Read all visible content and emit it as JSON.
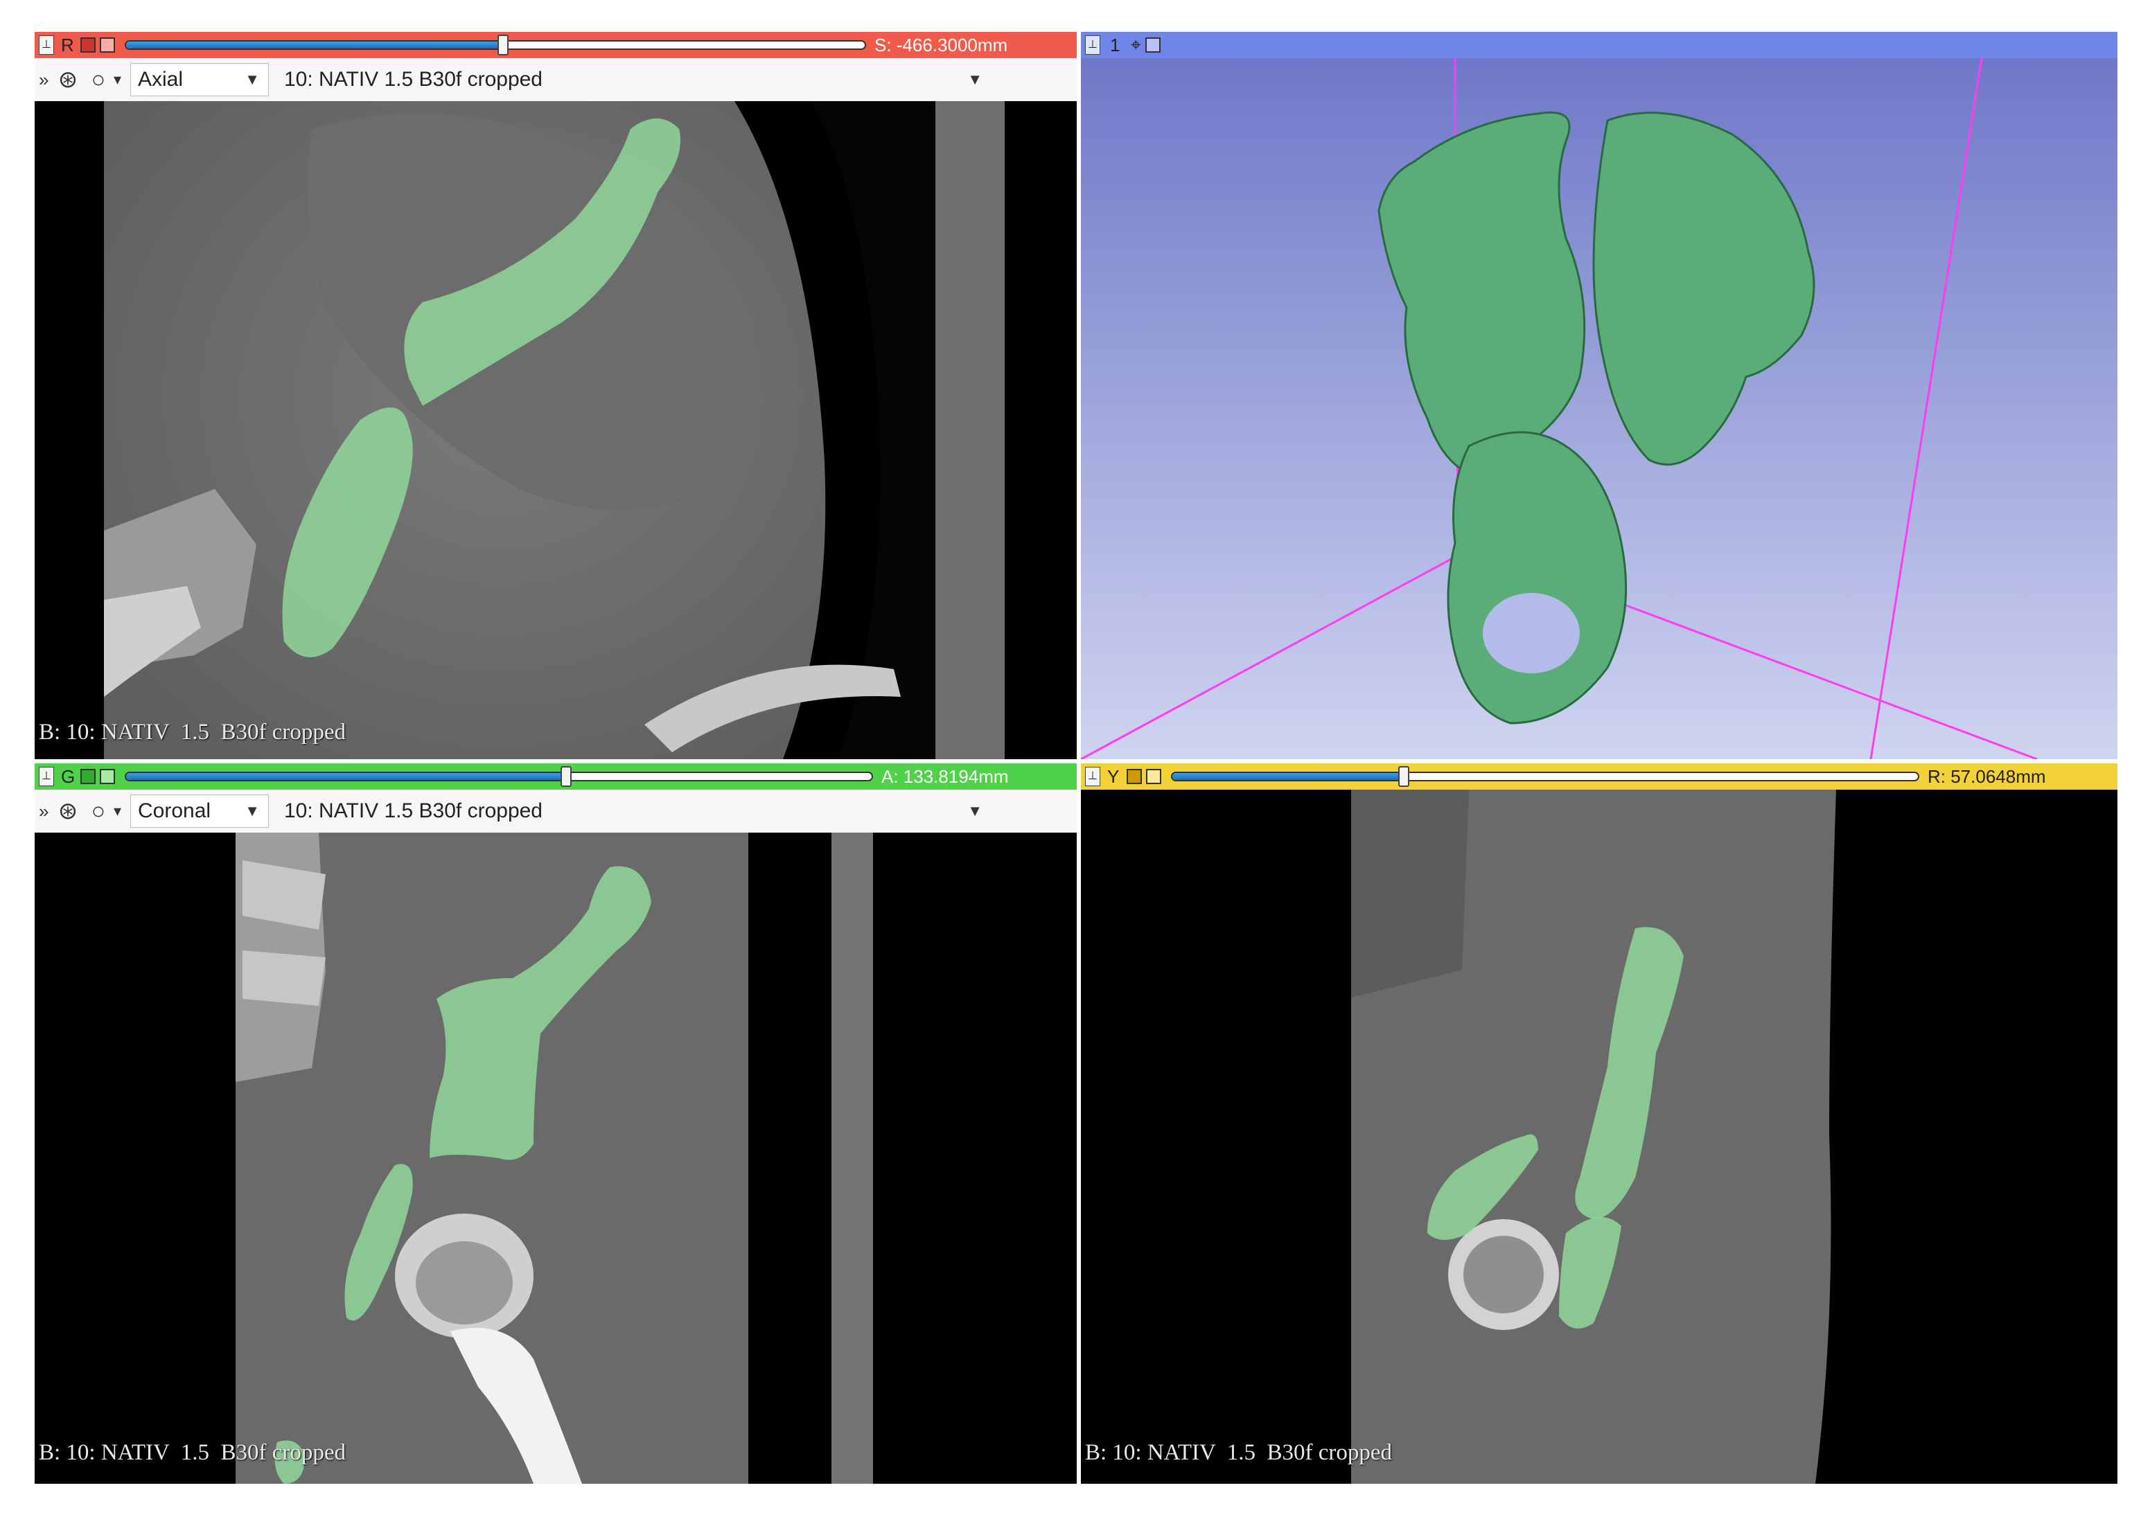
{
  "views": {
    "axial": {
      "bar_label": "R",
      "coordinate": "S: -466.3000mm",
      "slider_fraction": 0.51,
      "orientation": "Axial",
      "volume": "10: NATIV  1.5  B30f cropped",
      "caption": "B: 10: NATIV  1.5  B30f cropped",
      "bar_color": "#f05a4a"
    },
    "three_d": {
      "bar_label": "1",
      "bar_color": "#6f86e8",
      "background_top": "#6e78c8",
      "background_bottom": "#cfd4f0",
      "model_color": "#5aad78"
    },
    "coronal": {
      "bar_label": "G",
      "coordinate": "A: 133.8194mm",
      "slider_fraction": 0.59,
      "orientation": "Coronal",
      "volume": "10: NATIV  1.5  B30f cropped",
      "caption": "B: 10: NATIV  1.5  B30f cropped",
      "bar_color": "#4fd24a"
    },
    "sagittal": {
      "bar_label": "Y",
      "coordinate": "R: 57.0648mm",
      "slider_fraction": 0.31,
      "caption": "B: 10: NATIV  1.5  B30f cropped",
      "bar_color": "#f2d238"
    }
  },
  "icons": {
    "pin": "pin-icon",
    "link": "link-icon",
    "visibility": "eye-icon",
    "maximize": "maximize-icon",
    "more": "chevron-double-right-icon",
    "layers": "layer-stack-icon",
    "oval": "outline-oval-icon",
    "dropdown": "chevron-down-icon"
  },
  "segment_color": "#8fd79a"
}
